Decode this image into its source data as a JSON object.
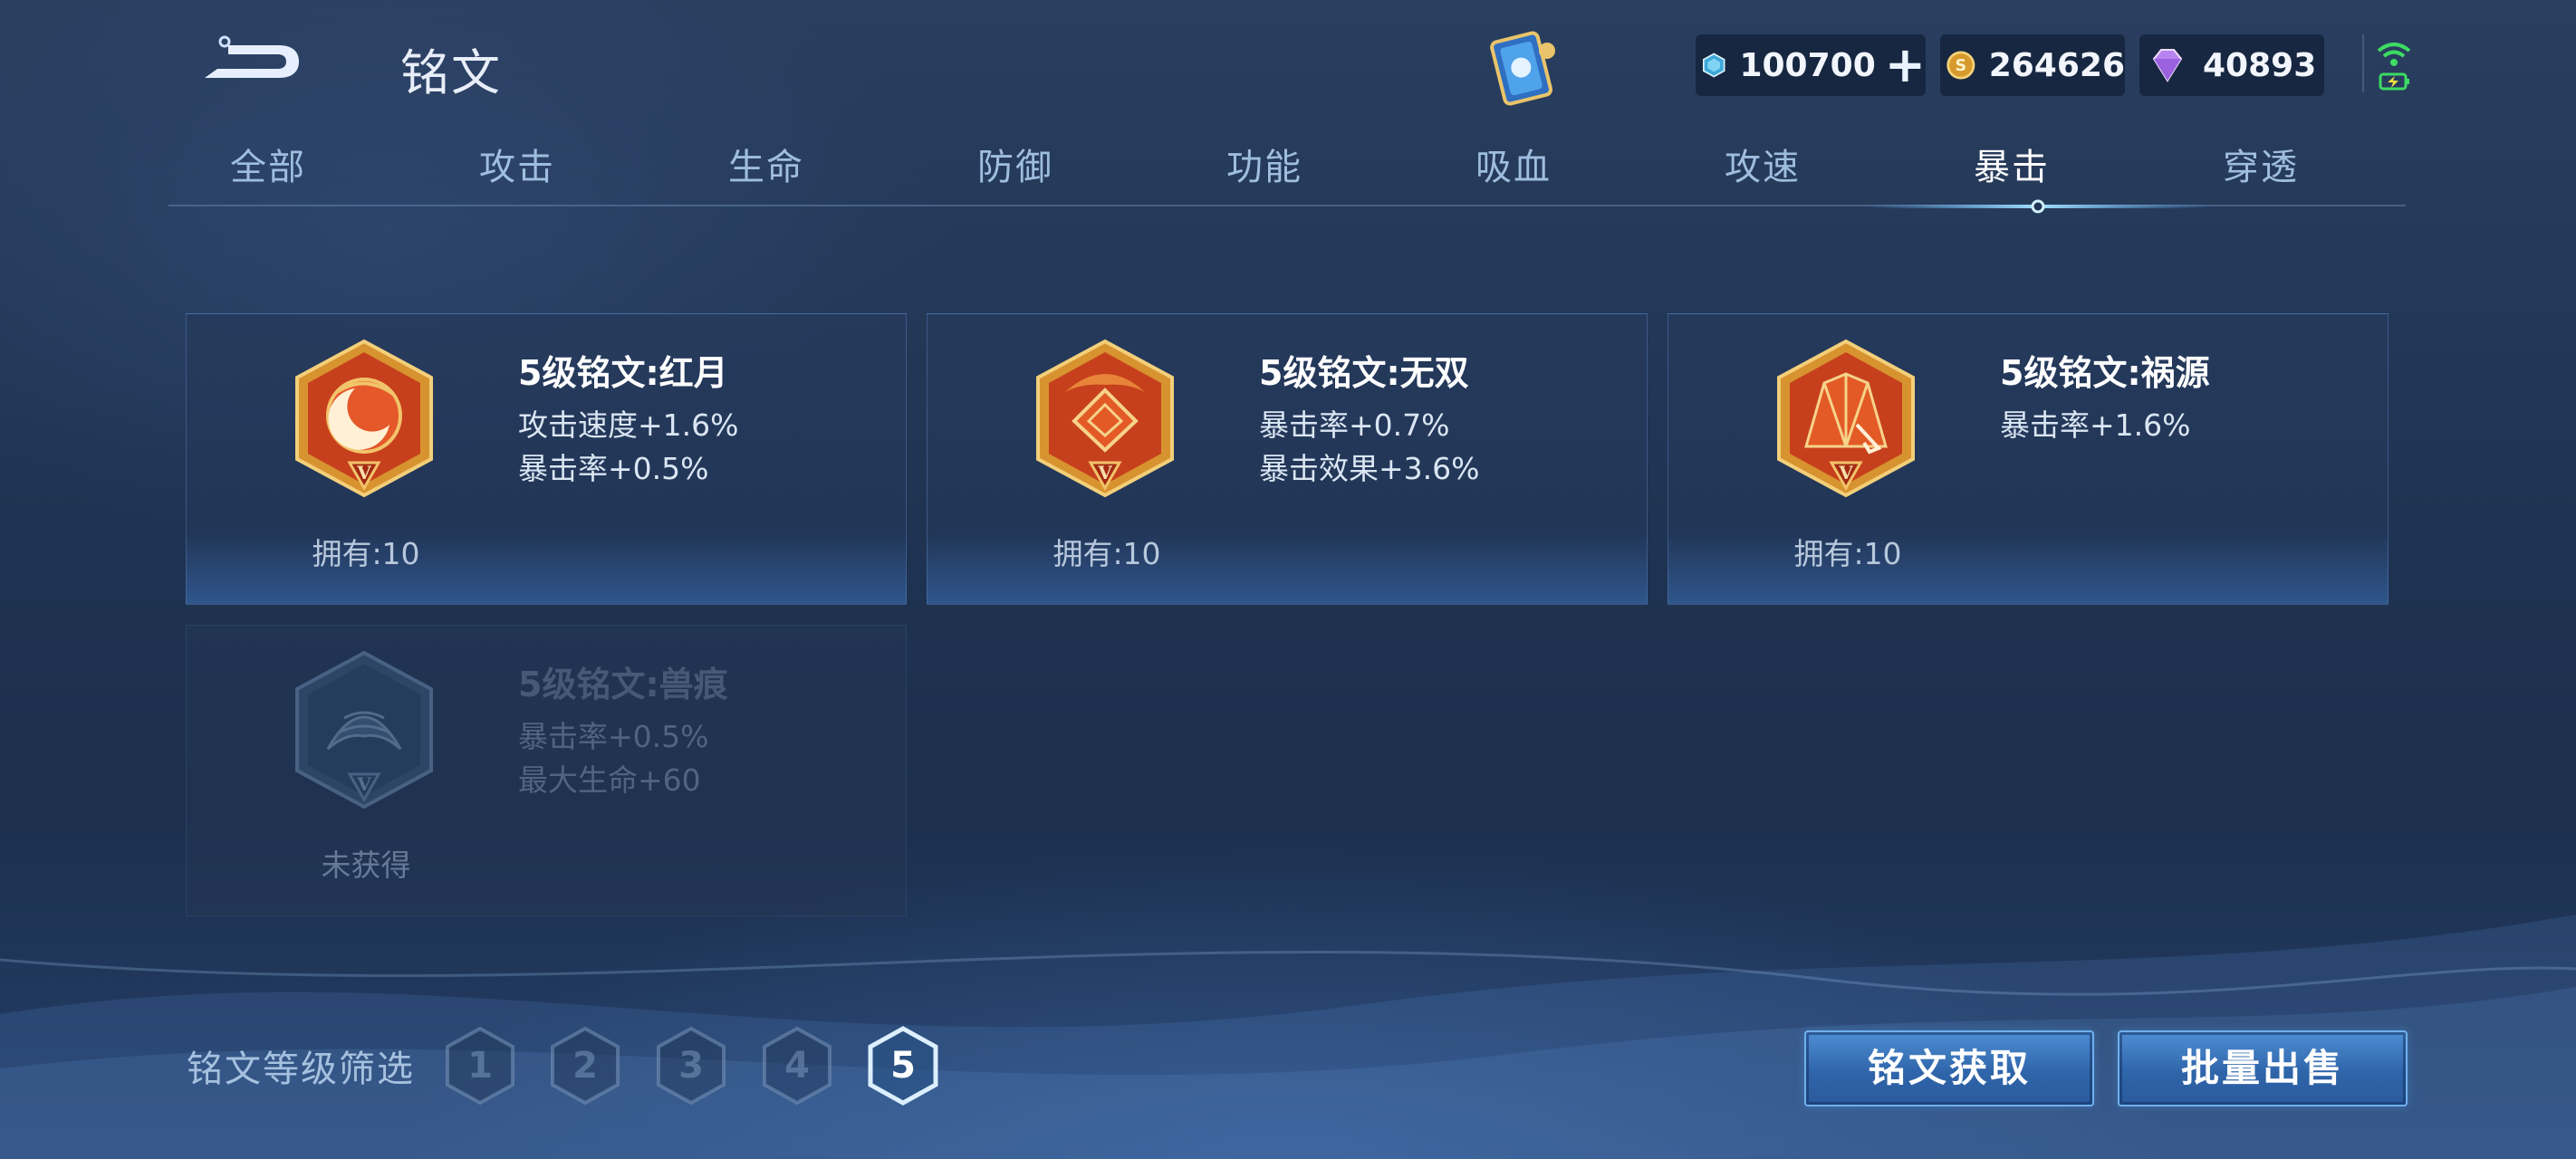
{
  "header": {
    "title": "铭文",
    "back_icon": "back-arrow-icon",
    "item_icon": "rune-card-item-icon"
  },
  "resources": {
    "vouchers": {
      "icon": "voucher-crystal-icon",
      "value": "100700",
      "plus_icon": "plus-icon",
      "plus_label": "+"
    },
    "gold": {
      "icon": "gold-coin-icon",
      "value": "264626"
    },
    "diamonds": {
      "icon": "diamond-gem-icon",
      "value": "40893"
    }
  },
  "status": {
    "icon": "wifi-battery-icon"
  },
  "tabs": [
    {
      "label": "全部",
      "active": false
    },
    {
      "label": "攻击",
      "active": false
    },
    {
      "label": "生命",
      "active": false
    },
    {
      "label": "防御",
      "active": false
    },
    {
      "label": "功能",
      "active": false
    },
    {
      "label": "吸血",
      "active": false
    },
    {
      "label": "攻速",
      "active": false
    },
    {
      "label": "暴击",
      "active": true
    },
    {
      "label": "穿透",
      "active": false
    }
  ],
  "runes": [
    {
      "name": "5级铭文:红月",
      "stats": [
        "攻击速度+1.6%",
        "暴击率+0.5%"
      ],
      "owned": "拥有:10",
      "icon": "red-moon-rune-icon",
      "locked": false
    },
    {
      "name": "5级铭文:无双",
      "stats": [
        "暴击率+0.7%",
        "暴击效果+3.6%"
      ],
      "owned": "拥有:10",
      "icon": "unrivaled-rune-icon",
      "locked": false
    },
    {
      "name": "5级铭文:祸源",
      "stats": [
        "暴击率+1.6%"
      ],
      "owned": "拥有:10",
      "icon": "calamity-rune-icon",
      "locked": false
    },
    {
      "name": "5级铭文:兽痕",
      "stats": [
        "暴击率+0.5%",
        "最大生命+60"
      ],
      "owned": "未获得",
      "icon": "beast-mark-rune-icon",
      "locked": true
    }
  ],
  "level_filter": {
    "label": "铭文等级筛选",
    "levels": [
      "1",
      "2",
      "3",
      "4",
      "5"
    ],
    "selected": "5"
  },
  "actions": {
    "get_label": "铭文获取",
    "sell_label": "批量出售"
  },
  "colors": {
    "background": "#1f3352",
    "rune_red": "#c8401c",
    "rune_gold": "#e0a43a",
    "button_blue": "#3b73bc",
    "tab_active": "#ffffff",
    "tab_inactive": "#9fbedf"
  }
}
